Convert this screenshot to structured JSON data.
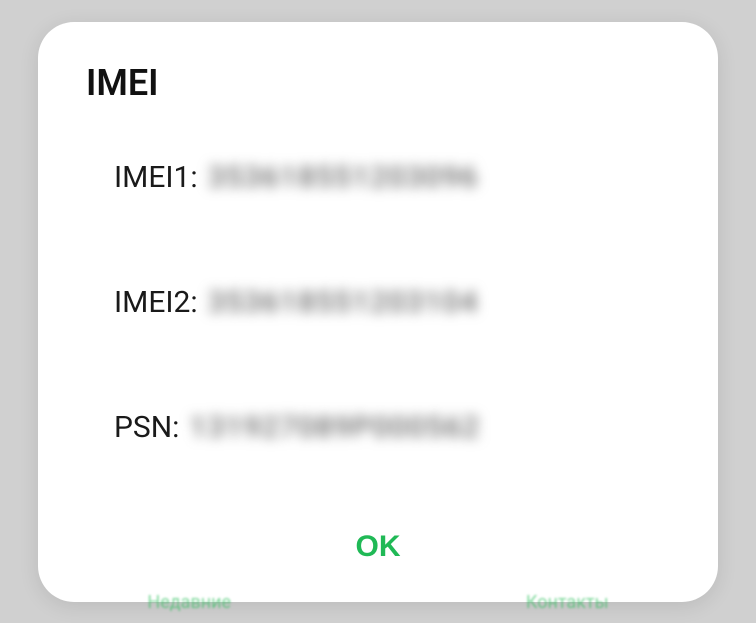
{
  "dialog": {
    "title": "IMEI",
    "rows": [
      {
        "label": "IMEI1:",
        "value": "353618551203096"
      },
      {
        "label": "IMEI2:",
        "value": "353618551203104"
      },
      {
        "label": "PSN:",
        "value": "131927089P000562"
      }
    ],
    "ok_label": "OK"
  },
  "background": {
    "left_tab": "Недавние",
    "right_tab": "Контакты"
  }
}
